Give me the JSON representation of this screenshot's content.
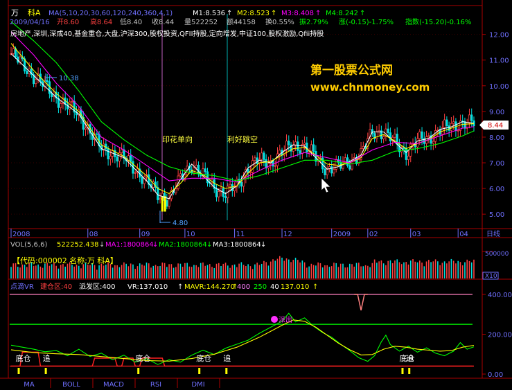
{
  "price_pane": {
    "symbol": "万",
    "name": "科A",
    "ma_title": "MA(5,10,20,30,60,120,240,360,4,1)",
    "ma_values": [
      {
        "label": "M1:8.536",
        "arrow": "↑",
        "color": "#ffffff"
      },
      {
        "label": "M2:8.523",
        "arrow": "↑",
        "color": "#ffff00"
      },
      {
        "label": "M3:8.408",
        "arrow": "↑",
        "color": "#ff00ff"
      },
      {
        "label": "M4:8.242",
        "arrow": "↑",
        "color": "#00ff00"
      }
    ],
    "info_date": "2009/04/16",
    "info_open": "开8.60",
    "info_high": "高8.64",
    "info_low": "低8.40",
    "info_close": "收8.44",
    "info_volume": "量522252",
    "info_amount": "额44158",
    "info_turnover": "换0.55%",
    "info_amplitude": "振2.79%",
    "info_change": "涨(-0.15)-1.75%",
    "info_index": "指数(-15.20)-0.16%",
    "sectors": "房地产,深圳,深成40,基金重仓,大盘,沪深300,股权投资,QFII持股,定向增发,中证100,股权激励,Qfii持股",
    "watermark_line1": "第一股票公式网",
    "watermark_line2": "www.chnmoney.com",
    "annotation_left": "印花单向",
    "annotation_right": "利好跳空",
    "high_marker": "10.38",
    "low_marker": "4.80",
    "current_price": "8.44",
    "ma_series_colors": {
      "m1": "#ffffff",
      "m2": "#ffff00",
      "m3": "#ff00ff",
      "m4": "#00ff00"
    }
  },
  "volume_pane": {
    "title": "VOL(5,6,6)",
    "vol": "522252.438",
    "ma1": "MA1:1800864",
    "ma2": "MA2:1800864",
    "ma3": "MA3:1800864",
    "code_label": "【代码:000002 名称:万  科A】",
    "axis_top": "500000",
    "axis_bottom": "X10"
  },
  "vr_pane": {
    "title": "点滴VR",
    "build_zone": "建仓区:40",
    "sell_zone": "派发区:400",
    "vr": "VR:137.010",
    "vr_arrow": "↑",
    "mavr": "MAVR:144.270",
    "mavr_arrow": "↑",
    "v400": "400",
    "v250": "250",
    "v40": "40",
    "vr_last": "137.010",
    "vr_last_arrow": "↑",
    "marker_top": "派出",
    "markers": [
      {
        "text": "底仓",
        "xd": 2
      },
      {
        "text": "追",
        "xd": 14
      },
      {
        "text": "底仓",
        "xd": 55
      },
      {
        "text": "底仓",
        "xd": 82
      },
      {
        "text": "追",
        "xd": 94
      },
      {
        "text": "底仓",
        "xd": 172
      },
      {
        "text": "追",
        "xd": 175
      }
    ]
  },
  "tabs": [
    "MA",
    "BOLL",
    "MACD",
    "RSI",
    "DMI"
  ],
  "time_axis_label": "日线",
  "chart_data": [
    {
      "type": "candlestick",
      "title": "",
      "ylim": [
        4.6,
        12.8
      ],
      "y_ticks": [
        5.0,
        6.0,
        7.0,
        8.0,
        9.0,
        10.0,
        11.0,
        12.0
      ],
      "x_labels": [
        {
          "label": "2008",
          "xd": 0
        },
        {
          "label": "08",
          "xd": 34
        },
        {
          "label": "09",
          "xd": 57
        },
        {
          "label": "10",
          "xd": 77
        },
        {
          "label": "11",
          "xd": 99
        },
        {
          "label": "12",
          "xd": 120
        },
        {
          "label": "2009",
          "xd": 142
        },
        {
          "label": "02",
          "xd": 158
        },
        {
          "label": "03",
          "xd": 177
        },
        {
          "label": "04",
          "xd": 198
        }
      ],
      "annotations": [
        {
          "text": "印花单向",
          "xd": 69
        },
        {
          "text": "利好跳空",
          "xd": 96
        }
      ],
      "series": [
        {
          "name": "M1",
          "values": [
            {
              "x": 0,
              "y": 11.25
            },
            {
              "x": 10,
              "y": 10.4
            },
            {
              "x": 20,
              "y": 9.55
            },
            {
              "x": 30,
              "y": 8.9
            },
            {
              "x": 40,
              "y": 7.55
            },
            {
              "x": 50,
              "y": 7.2
            },
            {
              "x": 60,
              "y": 6.3
            },
            {
              "x": 65,
              "y": 5.75
            },
            {
              "x": 70,
              "y": 5.6
            },
            {
              "x": 75,
              "y": 6.35
            },
            {
              "x": 80,
              "y": 6.95
            },
            {
              "x": 85,
              "y": 6.5
            },
            {
              "x": 90,
              "y": 6.05
            },
            {
              "x": 95,
              "y": 5.8
            },
            {
              "x": 100,
              "y": 6.1
            },
            {
              "x": 105,
              "y": 6.8
            },
            {
              "x": 110,
              "y": 7.1
            },
            {
              "x": 115,
              "y": 7.0
            },
            {
              "x": 120,
              "y": 7.4
            },
            {
              "x": 125,
              "y": 7.7
            },
            {
              "x": 130,
              "y": 7.65
            },
            {
              "x": 135,
              "y": 7.2
            },
            {
              "x": 140,
              "y": 6.75
            },
            {
              "x": 145,
              "y": 6.85
            },
            {
              "x": 150,
              "y": 7.05
            },
            {
              "x": 155,
              "y": 7.3
            },
            {
              "x": 160,
              "y": 8.2
            },
            {
              "x": 165,
              "y": 8.2
            },
            {
              "x": 170,
              "y": 7.8
            },
            {
              "x": 175,
              "y": 7.4
            },
            {
              "x": 180,
              "y": 7.85
            },
            {
              "x": 185,
              "y": 7.95
            },
            {
              "x": 190,
              "y": 8.3
            },
            {
              "x": 195,
              "y": 8.4
            },
            {
              "x": 200,
              "y": 8.6
            },
            {
              "x": 205,
              "y": 8.536
            }
          ]
        },
        {
          "name": "M2",
          "values": [
            {
              "x": 0,
              "y": 11.65
            },
            {
              "x": 10,
              "y": 10.6
            },
            {
              "x": 20,
              "y": 9.7
            },
            {
              "x": 30,
              "y": 9.0
            },
            {
              "x": 40,
              "y": 7.7
            },
            {
              "x": 50,
              "y": 7.25
            },
            {
              "x": 60,
              "y": 6.5
            },
            {
              "x": 65,
              "y": 6.0
            },
            {
              "x": 70,
              "y": 5.8
            },
            {
              "x": 75,
              "y": 6.2
            },
            {
              "x": 80,
              "y": 6.7
            },
            {
              "x": 85,
              "y": 6.55
            },
            {
              "x": 90,
              "y": 6.2
            },
            {
              "x": 95,
              "y": 6.0
            },
            {
              "x": 100,
              "y": 6.1
            },
            {
              "x": 105,
              "y": 6.6
            },
            {
              "x": 110,
              "y": 7.0
            },
            {
              "x": 115,
              "y": 7.05
            },
            {
              "x": 120,
              "y": 7.3
            },
            {
              "x": 125,
              "y": 7.55
            },
            {
              "x": 130,
              "y": 7.6
            },
            {
              "x": 135,
              "y": 7.3
            },
            {
              "x": 140,
              "y": 6.95
            },
            {
              "x": 145,
              "y": 6.9
            },
            {
              "x": 150,
              "y": 7.0
            },
            {
              "x": 155,
              "y": 7.2
            },
            {
              "x": 160,
              "y": 7.95
            },
            {
              "x": 165,
              "y": 8.1
            },
            {
              "x": 170,
              "y": 7.85
            },
            {
              "x": 175,
              "y": 7.55
            },
            {
              "x": 180,
              "y": 7.75
            },
            {
              "x": 185,
              "y": 7.9
            },
            {
              "x": 190,
              "y": 8.2
            },
            {
              "x": 195,
              "y": 8.35
            },
            {
              "x": 200,
              "y": 8.5
            },
            {
              "x": 205,
              "y": 8.523
            }
          ]
        },
        {
          "name": "M3",
          "values": [
            {
              "x": 0,
              "y": 12.1
            },
            {
              "x": 10,
              "y": 11.2
            },
            {
              "x": 20,
              "y": 10.1
            },
            {
              "x": 30,
              "y": 9.2
            },
            {
              "x": 40,
              "y": 8.0
            },
            {
              "x": 50,
              "y": 7.5
            },
            {
              "x": 60,
              "y": 6.9
            },
            {
              "x": 70,
              "y": 6.3
            },
            {
              "x": 80,
              "y": 6.4
            },
            {
              "x": 90,
              "y": 6.4
            },
            {
              "x": 100,
              "y": 6.25
            },
            {
              "x": 110,
              "y": 6.7
            },
            {
              "x": 120,
              "y": 7.1
            },
            {
              "x": 130,
              "y": 7.4
            },
            {
              "x": 140,
              "y": 7.2
            },
            {
              "x": 150,
              "y": 7.0
            },
            {
              "x": 160,
              "y": 7.5
            },
            {
              "x": 170,
              "y": 7.8
            },
            {
              "x": 180,
              "y": 7.75
            },
            {
              "x": 190,
              "y": 8.05
            },
            {
              "x": 200,
              "y": 8.35
            },
            {
              "x": 205,
              "y": 8.408
            }
          ]
        },
        {
          "name": "M4",
          "values": [
            {
              "x": 0,
              "y": 12.5
            },
            {
              "x": 10,
              "y": 11.75
            },
            {
              "x": 20,
              "y": 10.9
            },
            {
              "x": 30,
              "y": 9.8
            },
            {
              "x": 40,
              "y": 8.6
            },
            {
              "x": 50,
              "y": 7.9
            },
            {
              "x": 60,
              "y": 7.3
            },
            {
              "x": 70,
              "y": 6.85
            },
            {
              "x": 80,
              "y": 6.6
            },
            {
              "x": 90,
              "y": 6.5
            },
            {
              "x": 100,
              "y": 6.3
            },
            {
              "x": 110,
              "y": 6.5
            },
            {
              "x": 120,
              "y": 6.8
            },
            {
              "x": 130,
              "y": 7.1
            },
            {
              "x": 140,
              "y": 7.1
            },
            {
              "x": 150,
              "y": 6.95
            },
            {
              "x": 160,
              "y": 7.1
            },
            {
              "x": 170,
              "y": 7.45
            },
            {
              "x": 180,
              "y": 7.55
            },
            {
              "x": 190,
              "y": 7.75
            },
            {
              "x": 200,
              "y": 8.05
            },
            {
              "x": 205,
              "y": 8.242
            }
          ]
        }
      ]
    },
    {
      "type": "bar",
      "title": "VOL(5,6,6)",
      "ylim": [
        0,
        500000
      ],
      "y_ticks": [
        500000
      ],
      "x_range": [
        0,
        205
      ]
    },
    {
      "type": "line",
      "title": "点滴VR",
      "ylim": [
        0,
        400
      ],
      "y_ticks": [
        0,
        200,
        400
      ],
      "reference_lines": [
        {
          "name": "400",
          "value": 400,
          "color": "#ff80c0"
        },
        {
          "name": "250",
          "value": 250,
          "color": "#00ff00"
        },
        {
          "name": "40",
          "value": 40,
          "color": "#ff2020"
        }
      ],
      "series": [
        {
          "name": "VR",
          "values": [
            {
              "x": 0,
              "y": 145
            },
            {
              "x": 5,
              "y": 135
            },
            {
              "x": 10,
              "y": 125
            },
            {
              "x": 15,
              "y": 112
            },
            {
              "x": 20,
              "y": 118
            },
            {
              "x": 25,
              "y": 92
            },
            {
              "x": 30,
              "y": 125
            },
            {
              "x": 35,
              "y": 88
            },
            {
              "x": 40,
              "y": 105
            },
            {
              "x": 45,
              "y": 72
            },
            {
              "x": 50,
              "y": 95
            },
            {
              "x": 55,
              "y": 60
            },
            {
              "x": 60,
              "y": 78
            },
            {
              "x": 65,
              "y": 48
            },
            {
              "x": 70,
              "y": 72
            },
            {
              "x": 75,
              "y": 60
            },
            {
              "x": 80,
              "y": 95
            },
            {
              "x": 85,
              "y": 120
            },
            {
              "x": 90,
              "y": 98
            },
            {
              "x": 95,
              "y": 130
            },
            {
              "x": 100,
              "y": 150
            },
            {
              "x": 105,
              "y": 170
            },
            {
              "x": 110,
              "y": 205
            },
            {
              "x": 115,
              "y": 235
            },
            {
              "x": 120,
              "y": 265
            },
            {
              "x": 123,
              "y": 305
            },
            {
              "x": 126,
              "y": 262
            },
            {
              "x": 130,
              "y": 282
            },
            {
              "x": 134,
              "y": 240
            },
            {
              "x": 138,
              "y": 208
            },
            {
              "x": 142,
              "y": 185
            },
            {
              "x": 146,
              "y": 150
            },
            {
              "x": 150,
              "y": 118
            },
            {
              "x": 154,
              "y": 82
            },
            {
              "x": 158,
              "y": 64
            },
            {
              "x": 161,
              "y": 92
            },
            {
              "x": 164,
              "y": 162
            },
            {
              "x": 166,
              "y": 195
            },
            {
              "x": 168,
              "y": 148
            },
            {
              "x": 172,
              "y": 115
            },
            {
              "x": 176,
              "y": 140
            },
            {
              "x": 180,
              "y": 110
            },
            {
              "x": 184,
              "y": 132
            },
            {
              "x": 188,
              "y": 105
            },
            {
              "x": 192,
              "y": 92
            },
            {
              "x": 196,
              "y": 115
            },
            {
              "x": 199,
              "y": 158
            },
            {
              "x": 202,
              "y": 125
            },
            {
              "x": 205,
              "y": 137.01
            }
          ]
        },
        {
          "name": "MAVR",
          "values": [
            {
              "x": 0,
              "y": 122
            },
            {
              "x": 10,
              "y": 108
            },
            {
              "x": 20,
              "y": 102
            },
            {
              "x": 30,
              "y": 98
            },
            {
              "x": 40,
              "y": 88
            },
            {
              "x": 50,
              "y": 78
            },
            {
              "x": 60,
              "y": 68
            },
            {
              "x": 70,
              "y": 65
            },
            {
              "x": 80,
              "y": 78
            },
            {
              "x": 90,
              "y": 100
            },
            {
              "x": 100,
              "y": 135
            },
            {
              "x": 110,
              "y": 185
            },
            {
              "x": 120,
              "y": 245
            },
            {
              "x": 125,
              "y": 272
            },
            {
              "x": 130,
              "y": 265
            },
            {
              "x": 135,
              "y": 235
            },
            {
              "x": 140,
              "y": 195
            },
            {
              "x": 145,
              "y": 155
            },
            {
              "x": 150,
              "y": 122
            },
            {
              "x": 155,
              "y": 96
            },
            {
              "x": 160,
              "y": 98
            },
            {
              "x": 165,
              "y": 125
            },
            {
              "x": 170,
              "y": 140
            },
            {
              "x": 175,
              "y": 135
            },
            {
              "x": 180,
              "y": 125
            },
            {
              "x": 185,
              "y": 120
            },
            {
              "x": 190,
              "y": 115
            },
            {
              "x": 195,
              "y": 118
            },
            {
              "x": 200,
              "y": 135
            },
            {
              "x": 205,
              "y": 144.27
            }
          ]
        }
      ]
    }
  ]
}
